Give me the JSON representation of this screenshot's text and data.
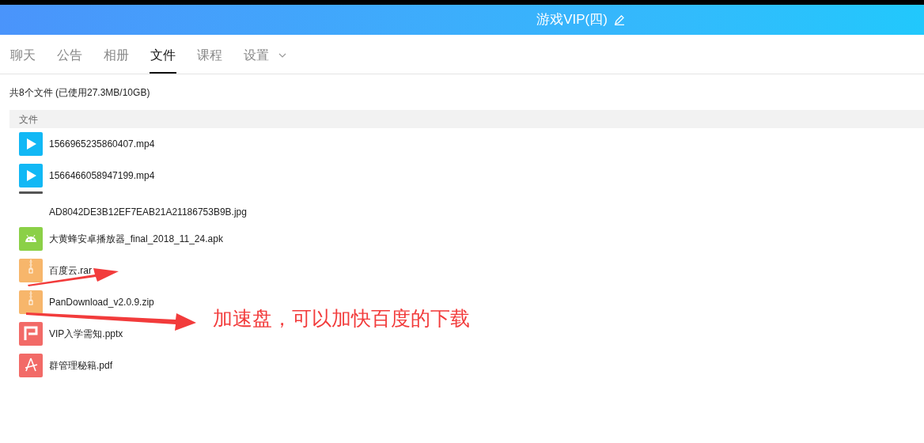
{
  "window": {
    "title": "游戏VIP(四)"
  },
  "tabs": [
    {
      "label": "聊天",
      "selected": false
    },
    {
      "label": "公告",
      "selected": false
    },
    {
      "label": "相册",
      "selected": false
    },
    {
      "label": "文件",
      "selected": true
    },
    {
      "label": "课程",
      "selected": false
    },
    {
      "label": "设置",
      "selected": false,
      "dropdown": true
    }
  ],
  "summary": "共8个文件 (已使用27.3MB/10GB)",
  "table": {
    "columns": [
      "文件"
    ],
    "rows": [
      {
        "name": "1566965235860407.mp4",
        "kind": "video"
      },
      {
        "name": "1566466058947199.mp4",
        "kind": "video"
      },
      {
        "name": "AD8042DE3B12EF7EAB21A21186753B9B.jpg",
        "kind": "image"
      },
      {
        "name": "大黄蜂安卓播放器_final_2018_11_24.apk",
        "kind": "apk"
      },
      {
        "name": "百度云.rar",
        "kind": "archive"
      },
      {
        "name": "PanDownload_v2.0.9.zip",
        "kind": "archive"
      },
      {
        "name": "VIP入学需知.pptx",
        "kind": "ppt"
      },
      {
        "name": "群管理秘籍.pdf",
        "kind": "pdf"
      }
    ]
  },
  "annotation": "加速盘，可以加快百度的下载"
}
